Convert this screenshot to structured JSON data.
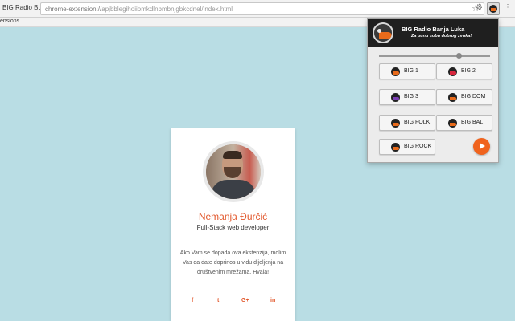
{
  "browser": {
    "tab_title": "BIG Radio BL",
    "url_host": "chrome-extension://",
    "url_path": "apjbblegihoiiomkdlnbmbnjgbkcdnel/index.html",
    "bookmarks_label": "ensions"
  },
  "profile": {
    "name": "Nemanja Đurčić",
    "role": "Full-Stack web developer",
    "message": "Ako Vam se dopada ova ekstenzija, molim Vas da date doprinos u vidu dijeljenja na društvenim mrežama. Hvala!",
    "social": [
      "f",
      "t",
      "G+",
      "in"
    ]
  },
  "popup": {
    "title": "BIG Radio Banja Luka",
    "subtitle": "Za punu sobu dobrog zvuka!",
    "volume_fraction": 0.72,
    "stations": [
      {
        "label": "BIG 1",
        "color": "#e86a1a"
      },
      {
        "label": "BIG 2",
        "color": "#d7263d"
      },
      {
        "label": "BIG 3",
        "color": "#7b3fb5"
      },
      {
        "label": "BIG DOM",
        "color": "#e86a1a"
      },
      {
        "label": "BIG FOLK",
        "color": "#e86a1a"
      },
      {
        "label": "BIG BAL",
        "color": "#e86a1a"
      },
      {
        "label": "BIG ROCK",
        "color": "#e86a1a"
      }
    ],
    "play_icon": "play-icon"
  }
}
